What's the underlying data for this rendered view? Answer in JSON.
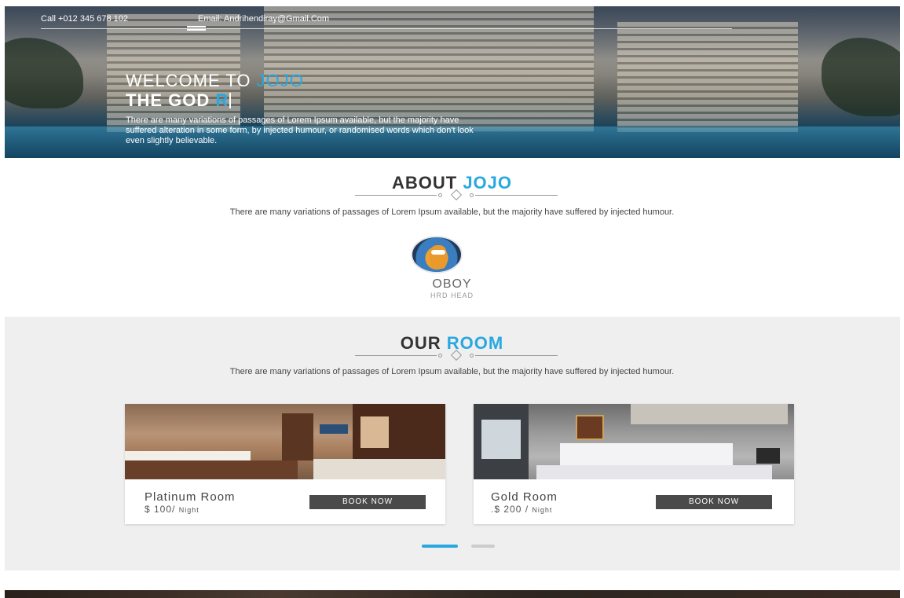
{
  "topbar": {
    "call": "Call +012 345 678 102",
    "email": "Email: Andrihendiray@Gmail.Com"
  },
  "hero": {
    "welcome": "WELCOME TO ",
    "welcome_accent": "JOJO",
    "subtitle": "THE GOD ",
    "subtitle_accent": "R",
    "text": "There are many variations of passages of Lorem Ipsum available, but the majority have suffered alteration in some form, by injected humour, or randomised words which don't look even slightly believable."
  },
  "about": {
    "title": "ABOUT ",
    "title_accent": "JOJO",
    "text": "There are many variations of passages of Lorem Ipsum available, but the majority have suffered by injected humour.",
    "person_name": "OBOY",
    "person_role": "HRD HEAD"
  },
  "rooms": {
    "title": "OUR ",
    "title_accent": "ROOM",
    "text": "There are many variations of passages of Lorem Ipsum available, but the majority have suffered by injected humour.",
    "items": [
      {
        "name": "Platinum Room",
        "price": "$ 100/ ",
        "unit": "Night",
        "button": "BOOK NOW"
      },
      {
        "name": "Gold Room",
        "price": ".$ 200 / ",
        "unit": "Night",
        "button": "BOOK NOW"
      }
    ],
    "slider": {
      "active_index": 0,
      "count": 2
    }
  },
  "colors": {
    "accent": "#29a8e0",
    "button": "#4a4a4a",
    "section_bg": "#efefef",
    "dot_inactive": "#cccccc"
  },
  "icons": {
    "menu": "hamburger-icon"
  }
}
